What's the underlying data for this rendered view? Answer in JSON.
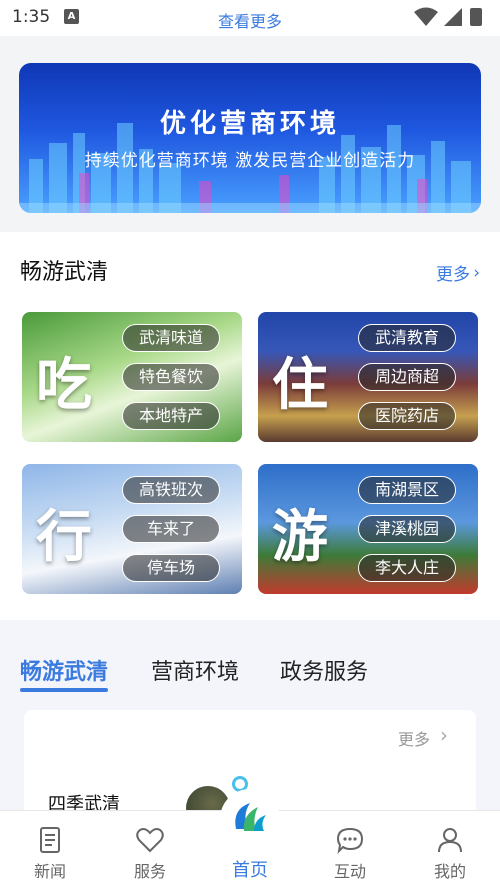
{
  "status_bar": {
    "time": "1:35",
    "center_link": "查看更多"
  },
  "banner": {
    "title": "优化营商环境",
    "subtitle": "持续优化营商环境  激发民营企业创造活力"
  },
  "section_tour": {
    "title": "畅游武清",
    "more_label": "更多",
    "cards": [
      {
        "big_char": "吃",
        "tags": [
          "武清味道",
          "特色餐饮",
          "本地特产"
        ]
      },
      {
        "big_char": "住",
        "tags": [
          "武清教育",
          "周边商超",
          "医院药店"
        ]
      },
      {
        "big_char": "行",
        "tags": [
          "高铁班次",
          "车来了",
          "停车场"
        ]
      },
      {
        "big_char": "游",
        "tags": [
          "南湖景区",
          "津溪桃园",
          "李大人庄"
        ]
      }
    ]
  },
  "tabs": {
    "items": [
      "畅游武清",
      "营商环境",
      "政务服务"
    ],
    "active": 0
  },
  "panel": {
    "more_label": "更多",
    "title": "四季武清"
  },
  "bottom_nav": {
    "items": [
      "新闻",
      "服务",
      "首页",
      "互动",
      "我的"
    ],
    "active_index": 2
  },
  "colors": {
    "accent": "#3b7be0",
    "text": "#222222",
    "muted": "#999999"
  }
}
